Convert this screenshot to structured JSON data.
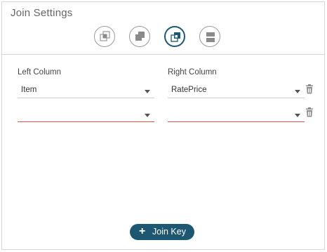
{
  "panel": {
    "title": "Join Settings"
  },
  "join_types": [
    {
      "name": "inner-join",
      "active": false
    },
    {
      "name": "left-join",
      "active": false
    },
    {
      "name": "right-join",
      "active": true
    },
    {
      "name": "outer-join",
      "active": false
    }
  ],
  "columns": {
    "left_label": "Left Column",
    "right_label": "Right Column"
  },
  "rows": [
    {
      "left": "Item",
      "right": "RatePrice"
    },
    {
      "left": "",
      "right": ""
    }
  ],
  "actions": {
    "join_key_label": "Join Key"
  },
  "colors": {
    "accent": "#1d5771",
    "error_underline": "#e0553c",
    "icon_gray": "#9a9a9a"
  },
  "icons": {
    "delete": "trash-icon",
    "add": "plus-icon",
    "dropdown": "chevron-down-icon"
  }
}
